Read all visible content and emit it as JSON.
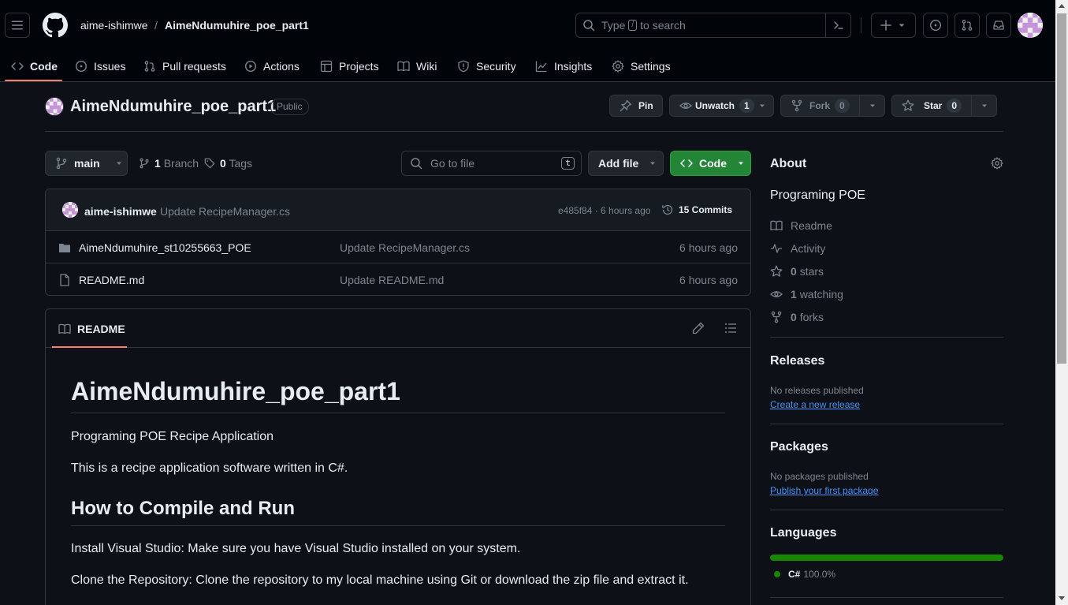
{
  "header": {
    "owner": "aime-ishimwe",
    "separator": "/",
    "repo": "AimeNdumuhire_poe_part1",
    "search_prefix": "Type",
    "search_key": "/",
    "search_suffix": "to search"
  },
  "tabs": [
    {
      "label": "Code",
      "icon": "code-icon",
      "active": true
    },
    {
      "label": "Issues",
      "icon": "issue-icon"
    },
    {
      "label": "Pull requests",
      "icon": "pull-request-icon"
    },
    {
      "label": "Actions",
      "icon": "play-icon"
    },
    {
      "label": "Projects",
      "icon": "table-icon"
    },
    {
      "label": "Wiki",
      "icon": "book-icon"
    },
    {
      "label": "Security",
      "icon": "shield-icon"
    },
    {
      "label": "Insights",
      "icon": "graph-icon"
    },
    {
      "label": "Settings",
      "icon": "gear-icon"
    }
  ],
  "repo": {
    "title": "AimeNdumuhire_poe_part1",
    "visibility": "Public",
    "pin_label": "Pin",
    "unwatch_label": "Unwatch",
    "watch_count": "1",
    "fork_label": "Fork",
    "fork_count": "0",
    "star_label": "Star",
    "star_count": "0"
  },
  "branch": {
    "name": "main",
    "branch_count": "1",
    "branch_label": "Branch",
    "tag_count": "0",
    "tag_label": "Tags",
    "goto_placeholder": "Go to file",
    "goto_key": "t",
    "add_file_label": "Add file",
    "code_label": "Code"
  },
  "commit": {
    "author": "aime-ishimwe",
    "message": "Update RecipeManager.cs",
    "hash_time": "e485f84 · 6 hours ago",
    "commits_label": "15 Commits"
  },
  "files": [
    {
      "name": "AimeNdumuhire_st10255663_POE",
      "type": "folder",
      "message": "Update RecipeManager.cs",
      "time": "6 hours ago"
    },
    {
      "name": "README.md",
      "type": "file",
      "message": "Update README.md",
      "time": "6 hours ago"
    }
  ],
  "readme": {
    "tab_label": "README",
    "h1": "AimeNdumuhire_poe_part1",
    "p1": "Programing POE Recipe Application",
    "p2": "This is a recipe application software written in C#.",
    "h2": "How to Compile and Run",
    "p3": "Install Visual Studio: Make sure you have Visual Studio installed on your system.",
    "p4": "Clone the Repository: Clone the repository to my local machine using Git or download the zip file and extract it."
  },
  "about": {
    "heading": "About",
    "description": "Programing POE",
    "readme": "Readme",
    "activity": "Activity",
    "stars_count": "0",
    "stars_label": "stars",
    "watching_count": "1",
    "watching_label": "watching",
    "forks_count": "0",
    "forks_label": "forks"
  },
  "releases": {
    "heading": "Releases",
    "empty": "No releases published",
    "link": "Create a new release"
  },
  "packages": {
    "heading": "Packages",
    "empty": "No packages published",
    "link": "Publish your first package"
  },
  "languages": {
    "heading": "Languages",
    "items": [
      {
        "name": "C#",
        "percent": "100.0%",
        "share": 1.0,
        "color": "#178600"
      }
    ]
  },
  "colors": {
    "accent_underline": "#f78166",
    "primary_green": "#238636",
    "link_blue": "#4493f8"
  }
}
